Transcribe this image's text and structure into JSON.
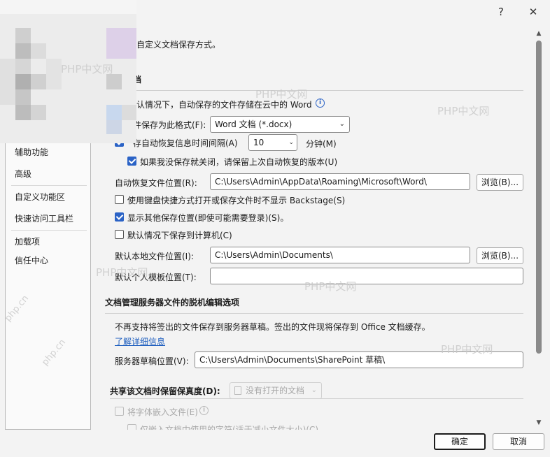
{
  "titlebar": {
    "help": "?",
    "close": "✕"
  },
  "sidebar": {
    "items": [
      {
        "label": "辅助功能"
      },
      {
        "label": "高级"
      },
      {
        "label": "自定义功能区"
      },
      {
        "label": "快速访问工具栏"
      },
      {
        "label": "加载项"
      },
      {
        "label": "信任中心"
      }
    ]
  },
  "content": {
    "intro": "自定义文档保存方式。",
    "save_section_partial": "档",
    "cloud_default_text": "认情况下，自动保存的文件存储在云中的 Word",
    "format_label": "件保存为此格式(F):",
    "format_value": "Word 文档 (*.docx)",
    "autorecover_label": "存自动恢复信息时间间隔(A)",
    "autorecover_value": "10",
    "minutes_label": "分钟(M)",
    "keep_last_label": "如果我没保存就关闭，请保留上次自动恢复的版本(U)",
    "autorecover_loc_label": "自动恢复文件位置(R):",
    "autorecover_loc_value": "C:\\Users\\Admin\\AppData\\Roaming\\Microsoft\\Word\\",
    "browse1": "浏览(B)...",
    "no_backstage_label": "使用键盘快捷方式打开或保存文件时不显示 Backstage(S)",
    "show_other_label": "显示其他保存位置(即使可能需要登录)(S)。",
    "save_to_computer_label": "默认情况下保存到计算机(C)",
    "local_loc_label": "默认本地文件位置(I):",
    "local_loc_value": "C:\\Users\\Admin\\Documents\\",
    "browse2": "浏览(B)...",
    "template_loc_label": "默认个人模板位置(T):",
    "template_loc_value": "",
    "offline_section": "文档管理服务器文件的脱机编辑选项",
    "offline_text": "不再支持将签出的文件保存到服务器草稿。签出的文件现将保存到 Office 文档缓存。",
    "learn_more": "了解详细信息",
    "drafts_label": "服务器草稿位置(V):",
    "drafts_value": "C:\\Users\\Admin\\Documents\\SharePoint 草稿\\",
    "fidelity_label": "共享该文档时保留保真度(D):",
    "fidelity_value": "没有打开的文档",
    "embed_fonts_label": "将字体嵌入文件(E)",
    "embed_chars_label": "仅嵌入文档中使用的字符(适于减小文件大小)(C)"
  },
  "footer": {
    "ok": "确定",
    "cancel": "取消"
  },
  "watermark": "PHP中文网",
  "watermark_small": "php.cn",
  "colors": {
    "accent": "#2b63c6",
    "link": "#1f5fbf"
  }
}
